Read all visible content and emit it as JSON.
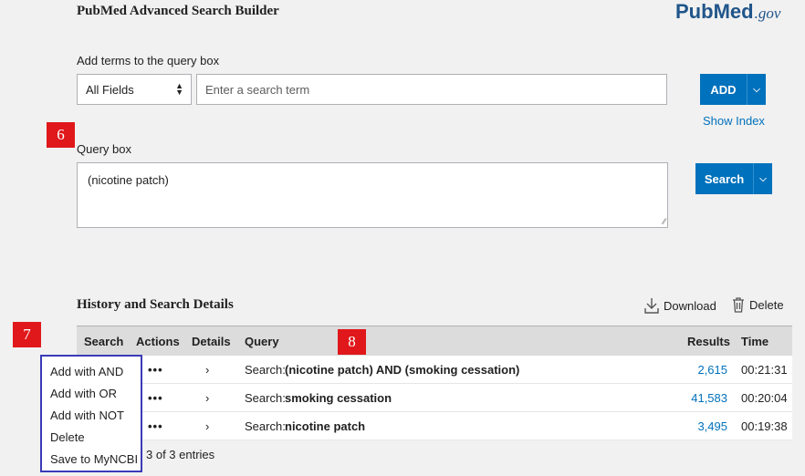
{
  "header": {
    "title": "PubMed Advanced Search Builder",
    "logo_pub": "Pub",
    "logo_med": "Med",
    "logo_gov": ".gov",
    "brand_color": "#20558a"
  },
  "builder": {
    "add_terms_label": "Add terms to the query box",
    "field_select_value": "All Fields",
    "term_placeholder": "Enter a search term",
    "add_button": "ADD",
    "show_index": "Show Index"
  },
  "query": {
    "label": "Query box",
    "value": "(nicotine patch)",
    "search_button": "Search"
  },
  "markers": {
    "m6": "6",
    "m7": "7",
    "m8": "8"
  },
  "history": {
    "title": "History and Search Details",
    "download": "Download",
    "delete": "Delete",
    "columns": {
      "search": "Search",
      "actions": "Actions",
      "details": "Details",
      "query": "Query",
      "results": "Results",
      "time": "Time"
    },
    "rows": [
      {
        "actions": "•••",
        "details": "›",
        "prefix": "Search:",
        "query": "(nicotine patch) AND (smoking cessation)",
        "results": "2,615",
        "time": "00:21:31"
      },
      {
        "actions": "•••",
        "details": "›",
        "prefix": "Search:",
        "query": "smoking cessation",
        "results": "41,583",
        "time": "00:20:04"
      },
      {
        "actions": "•••",
        "details": "›",
        "prefix": "Search:",
        "query": "nicotine patch",
        "results": "3,495",
        "time": "00:19:38"
      }
    ],
    "footer": "3 of 3 entries"
  },
  "context_menu": {
    "items": [
      "Add with AND",
      "Add with OR",
      "Add with NOT",
      "Delete",
      "Save to MyNCBI"
    ]
  },
  "colors": {
    "accent": "#0071bc",
    "marker": "#e0181b",
    "menu_border": "#3a3ab8"
  }
}
